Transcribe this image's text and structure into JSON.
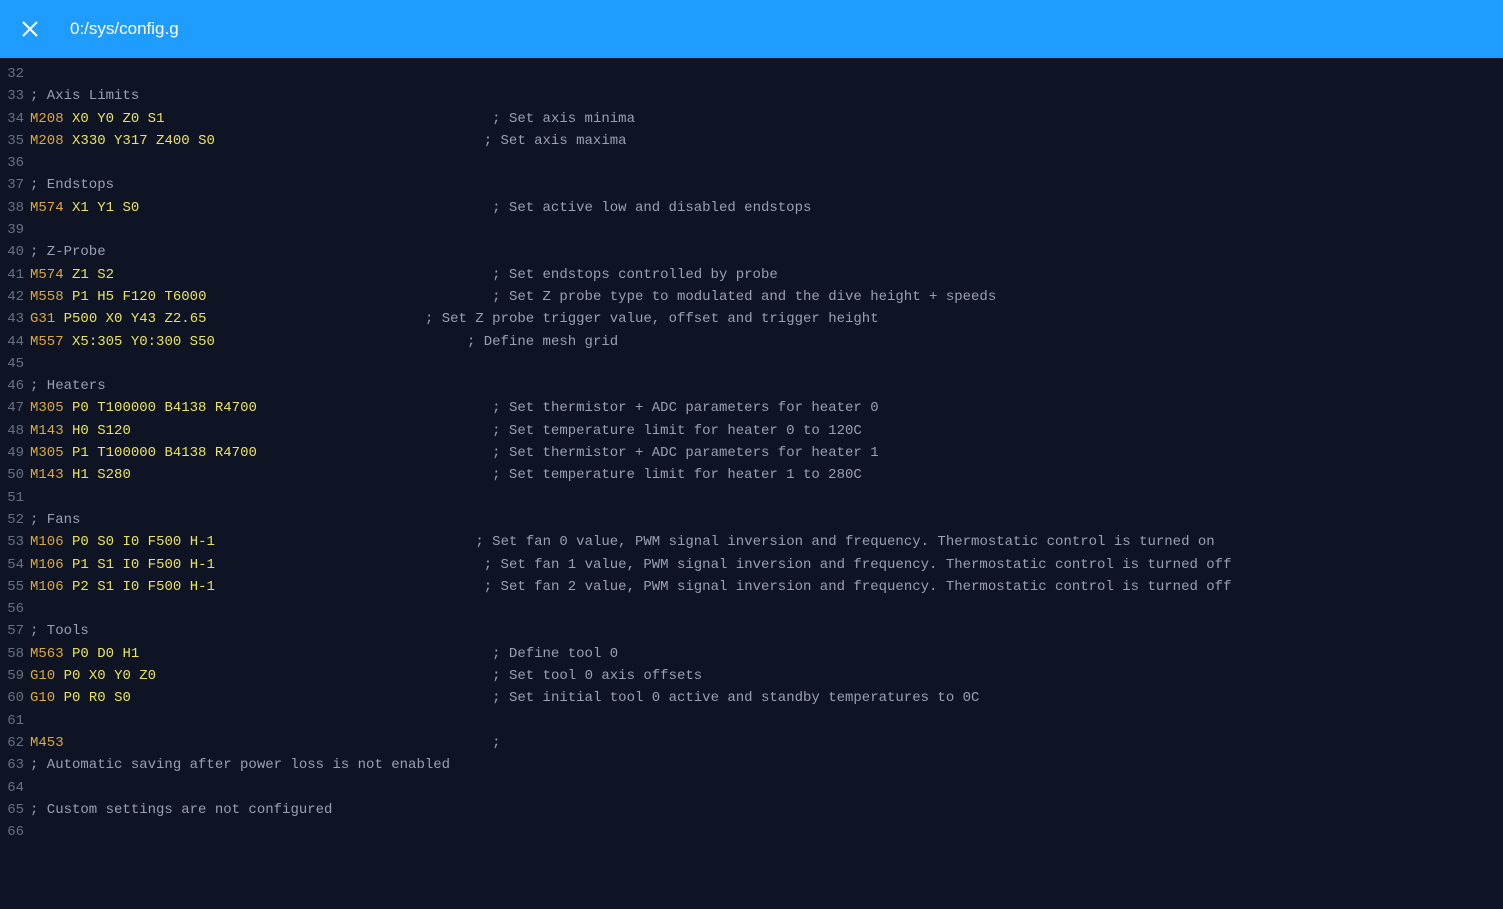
{
  "header": {
    "title": "0:/sys/config.g"
  },
  "code": [
    {
      "n": 32,
      "t": []
    },
    {
      "n": 33,
      "t": [
        {
          "c": "com",
          "s": "; Axis Limits"
        }
      ]
    },
    {
      "n": 34,
      "t": [
        {
          "c": "cmd",
          "s": "M208"
        },
        {
          "c": "txt",
          "s": " "
        },
        {
          "c": "param",
          "s": "X0"
        },
        {
          "c": "txt",
          "s": " "
        },
        {
          "c": "param",
          "s": "Y0"
        },
        {
          "c": "txt",
          "s": " "
        },
        {
          "c": "param",
          "s": "Z0"
        },
        {
          "c": "txt",
          "s": " "
        },
        {
          "c": "param",
          "s": "S1"
        },
        {
          "c": "txt",
          "s": "                                       "
        },
        {
          "c": "com",
          "s": "; Set axis minima"
        }
      ]
    },
    {
      "n": 35,
      "t": [
        {
          "c": "cmd",
          "s": "M208"
        },
        {
          "c": "txt",
          "s": " "
        },
        {
          "c": "param",
          "s": "X330"
        },
        {
          "c": "txt",
          "s": " "
        },
        {
          "c": "param",
          "s": "Y317"
        },
        {
          "c": "txt",
          "s": " "
        },
        {
          "c": "param",
          "s": "Z400"
        },
        {
          "c": "txt",
          "s": " "
        },
        {
          "c": "param",
          "s": "S0"
        },
        {
          "c": "txt",
          "s": "                                "
        },
        {
          "c": "com",
          "s": "; Set axis maxima"
        }
      ]
    },
    {
      "n": 36,
      "t": []
    },
    {
      "n": 37,
      "t": [
        {
          "c": "com",
          "s": "; Endstops"
        }
      ]
    },
    {
      "n": 38,
      "t": [
        {
          "c": "cmd",
          "s": "M574"
        },
        {
          "c": "txt",
          "s": " "
        },
        {
          "c": "param",
          "s": "X1"
        },
        {
          "c": "txt",
          "s": " "
        },
        {
          "c": "param",
          "s": "Y1"
        },
        {
          "c": "txt",
          "s": " "
        },
        {
          "c": "param",
          "s": "S0"
        },
        {
          "c": "txt",
          "s": "                                          "
        },
        {
          "c": "com",
          "s": "; Set active low and disabled endstops"
        }
      ]
    },
    {
      "n": 39,
      "t": []
    },
    {
      "n": 40,
      "t": [
        {
          "c": "com",
          "s": "; Z-Probe"
        }
      ]
    },
    {
      "n": 41,
      "t": [
        {
          "c": "cmd",
          "s": "M574"
        },
        {
          "c": "txt",
          "s": " "
        },
        {
          "c": "param",
          "s": "Z1"
        },
        {
          "c": "txt",
          "s": " "
        },
        {
          "c": "param",
          "s": "S2"
        },
        {
          "c": "txt",
          "s": "                                             "
        },
        {
          "c": "com",
          "s": "; Set endstops controlled by probe"
        }
      ]
    },
    {
      "n": 42,
      "t": [
        {
          "c": "cmd",
          "s": "M558"
        },
        {
          "c": "txt",
          "s": " "
        },
        {
          "c": "param",
          "s": "P1"
        },
        {
          "c": "txt",
          "s": " "
        },
        {
          "c": "param",
          "s": "H5"
        },
        {
          "c": "txt",
          "s": " "
        },
        {
          "c": "param",
          "s": "F120"
        },
        {
          "c": "txt",
          "s": " "
        },
        {
          "c": "param",
          "s": "T6000"
        },
        {
          "c": "txt",
          "s": "                                  "
        },
        {
          "c": "com",
          "s": "; Set Z probe type to modulated and the dive height + speeds"
        }
      ]
    },
    {
      "n": 43,
      "t": [
        {
          "c": "cmd",
          "s": "G31"
        },
        {
          "c": "txt",
          "s": " "
        },
        {
          "c": "param",
          "s": "P500"
        },
        {
          "c": "txt",
          "s": " "
        },
        {
          "c": "param",
          "s": "X0"
        },
        {
          "c": "txt",
          "s": " "
        },
        {
          "c": "param",
          "s": "Y43"
        },
        {
          "c": "txt",
          "s": " "
        },
        {
          "c": "param",
          "s": "Z2.65"
        },
        {
          "c": "txt",
          "s": "                          "
        },
        {
          "c": "com",
          "s": "; Set Z probe trigger value, offset and trigger height"
        }
      ]
    },
    {
      "n": 44,
      "t": [
        {
          "c": "cmd",
          "s": "M557"
        },
        {
          "c": "txt",
          "s": " "
        },
        {
          "c": "param",
          "s": "X5:305"
        },
        {
          "c": "txt",
          "s": " "
        },
        {
          "c": "param",
          "s": "Y0:300"
        },
        {
          "c": "txt",
          "s": " "
        },
        {
          "c": "param",
          "s": "S50"
        },
        {
          "c": "txt",
          "s": "                              "
        },
        {
          "c": "com",
          "s": "; Define mesh grid"
        }
      ]
    },
    {
      "n": 45,
      "t": []
    },
    {
      "n": 46,
      "t": [
        {
          "c": "com",
          "s": "; Heaters"
        }
      ]
    },
    {
      "n": 47,
      "t": [
        {
          "c": "cmd",
          "s": "M305"
        },
        {
          "c": "txt",
          "s": " "
        },
        {
          "c": "param",
          "s": "P0"
        },
        {
          "c": "txt",
          "s": " "
        },
        {
          "c": "param",
          "s": "T100000"
        },
        {
          "c": "txt",
          "s": " "
        },
        {
          "c": "param",
          "s": "B4138"
        },
        {
          "c": "txt",
          "s": " "
        },
        {
          "c": "param",
          "s": "R4700"
        },
        {
          "c": "txt",
          "s": "                            "
        },
        {
          "c": "com",
          "s": "; Set thermistor + ADC parameters for heater 0"
        }
      ]
    },
    {
      "n": 48,
      "t": [
        {
          "c": "cmd",
          "s": "M143"
        },
        {
          "c": "txt",
          "s": " "
        },
        {
          "c": "param",
          "s": "H0"
        },
        {
          "c": "txt",
          "s": " "
        },
        {
          "c": "param",
          "s": "S120"
        },
        {
          "c": "txt",
          "s": "                                           "
        },
        {
          "c": "com",
          "s": "; Set temperature limit for heater 0 to 120C"
        }
      ]
    },
    {
      "n": 49,
      "t": [
        {
          "c": "cmd",
          "s": "M305"
        },
        {
          "c": "txt",
          "s": " "
        },
        {
          "c": "param",
          "s": "P1"
        },
        {
          "c": "txt",
          "s": " "
        },
        {
          "c": "param",
          "s": "T100000"
        },
        {
          "c": "txt",
          "s": " "
        },
        {
          "c": "param",
          "s": "B4138"
        },
        {
          "c": "txt",
          "s": " "
        },
        {
          "c": "param",
          "s": "R4700"
        },
        {
          "c": "txt",
          "s": "                            "
        },
        {
          "c": "com",
          "s": "; Set thermistor + ADC parameters for heater 1"
        }
      ]
    },
    {
      "n": 50,
      "t": [
        {
          "c": "cmd",
          "s": "M143"
        },
        {
          "c": "txt",
          "s": " "
        },
        {
          "c": "param",
          "s": "H1"
        },
        {
          "c": "txt",
          "s": " "
        },
        {
          "c": "param",
          "s": "S280"
        },
        {
          "c": "txt",
          "s": "                                           "
        },
        {
          "c": "com",
          "s": "; Set temperature limit for heater 1 to 280C"
        }
      ]
    },
    {
      "n": 51,
      "t": []
    },
    {
      "n": 52,
      "t": [
        {
          "c": "com",
          "s": "; Fans"
        }
      ]
    },
    {
      "n": 53,
      "t": [
        {
          "c": "cmd",
          "s": "M106"
        },
        {
          "c": "txt",
          "s": " "
        },
        {
          "c": "param",
          "s": "P0"
        },
        {
          "c": "txt",
          "s": " "
        },
        {
          "c": "param",
          "s": "S0"
        },
        {
          "c": "txt",
          "s": " "
        },
        {
          "c": "param",
          "s": "I0"
        },
        {
          "c": "txt",
          "s": " "
        },
        {
          "c": "param",
          "s": "F500"
        },
        {
          "c": "txt",
          "s": " "
        },
        {
          "c": "param",
          "s": "H-1"
        },
        {
          "c": "txt",
          "s": "                               "
        },
        {
          "c": "com",
          "s": "; Set fan 0 value, PWM signal inversion and frequency. Thermostatic control is turned on"
        }
      ]
    },
    {
      "n": 54,
      "t": [
        {
          "c": "cmd",
          "s": "M106"
        },
        {
          "c": "txt",
          "s": " "
        },
        {
          "c": "param",
          "s": "P1"
        },
        {
          "c": "txt",
          "s": " "
        },
        {
          "c": "param",
          "s": "S1"
        },
        {
          "c": "txt",
          "s": " "
        },
        {
          "c": "param",
          "s": "I0"
        },
        {
          "c": "txt",
          "s": " "
        },
        {
          "c": "param",
          "s": "F500"
        },
        {
          "c": "txt",
          "s": " "
        },
        {
          "c": "param",
          "s": "H-1"
        },
        {
          "c": "txt",
          "s": "                                "
        },
        {
          "c": "com",
          "s": "; Set fan 1 value, PWM signal inversion and frequency. Thermostatic control is turned off"
        }
      ]
    },
    {
      "n": 55,
      "t": [
        {
          "c": "cmd",
          "s": "M106"
        },
        {
          "c": "txt",
          "s": " "
        },
        {
          "c": "param",
          "s": "P2"
        },
        {
          "c": "txt",
          "s": " "
        },
        {
          "c": "param",
          "s": "S1"
        },
        {
          "c": "txt",
          "s": " "
        },
        {
          "c": "param",
          "s": "I0"
        },
        {
          "c": "txt",
          "s": " "
        },
        {
          "c": "param",
          "s": "F500"
        },
        {
          "c": "txt",
          "s": " "
        },
        {
          "c": "param",
          "s": "H-1"
        },
        {
          "c": "txt",
          "s": "                                "
        },
        {
          "c": "com",
          "s": "; Set fan 2 value, PWM signal inversion and frequency. Thermostatic control is turned off"
        }
      ]
    },
    {
      "n": 56,
      "t": []
    },
    {
      "n": 57,
      "t": [
        {
          "c": "com",
          "s": "; Tools"
        }
      ]
    },
    {
      "n": 58,
      "t": [
        {
          "c": "cmd",
          "s": "M563"
        },
        {
          "c": "txt",
          "s": " "
        },
        {
          "c": "param",
          "s": "P0"
        },
        {
          "c": "txt",
          "s": " "
        },
        {
          "c": "param",
          "s": "D0"
        },
        {
          "c": "txt",
          "s": " "
        },
        {
          "c": "param",
          "s": "H1"
        },
        {
          "c": "txt",
          "s": "                                          "
        },
        {
          "c": "com",
          "s": "; Define tool 0"
        }
      ]
    },
    {
      "n": 59,
      "t": [
        {
          "c": "cmd",
          "s": "G10"
        },
        {
          "c": "txt",
          "s": " "
        },
        {
          "c": "param",
          "s": "P0"
        },
        {
          "c": "txt",
          "s": " "
        },
        {
          "c": "param",
          "s": "X0"
        },
        {
          "c": "txt",
          "s": " "
        },
        {
          "c": "param",
          "s": "Y0"
        },
        {
          "c": "txt",
          "s": " "
        },
        {
          "c": "param",
          "s": "Z0"
        },
        {
          "c": "txt",
          "s": "                                        "
        },
        {
          "c": "com",
          "s": "; Set tool 0 axis offsets"
        }
      ]
    },
    {
      "n": 60,
      "t": [
        {
          "c": "cmd",
          "s": "G10"
        },
        {
          "c": "txt",
          "s": " "
        },
        {
          "c": "param",
          "s": "P0"
        },
        {
          "c": "txt",
          "s": " "
        },
        {
          "c": "param",
          "s": "R0"
        },
        {
          "c": "txt",
          "s": " "
        },
        {
          "c": "param",
          "s": "S0"
        },
        {
          "c": "txt",
          "s": "                                           "
        },
        {
          "c": "com",
          "s": "; Set initial tool 0 active and standby temperatures to 0C"
        }
      ]
    },
    {
      "n": 61,
      "t": []
    },
    {
      "n": 62,
      "t": [
        {
          "c": "cmd",
          "s": "M453"
        },
        {
          "c": "txt",
          "s": "                                                   "
        },
        {
          "c": "com",
          "s": ";"
        }
      ]
    },
    {
      "n": 63,
      "t": [
        {
          "c": "com",
          "s": "; Automatic saving after power loss is not enabled"
        }
      ]
    },
    {
      "n": 64,
      "t": []
    },
    {
      "n": 65,
      "t": [
        {
          "c": "com",
          "s": "; Custom settings are not configured"
        }
      ]
    },
    {
      "n": 66,
      "t": []
    }
  ]
}
